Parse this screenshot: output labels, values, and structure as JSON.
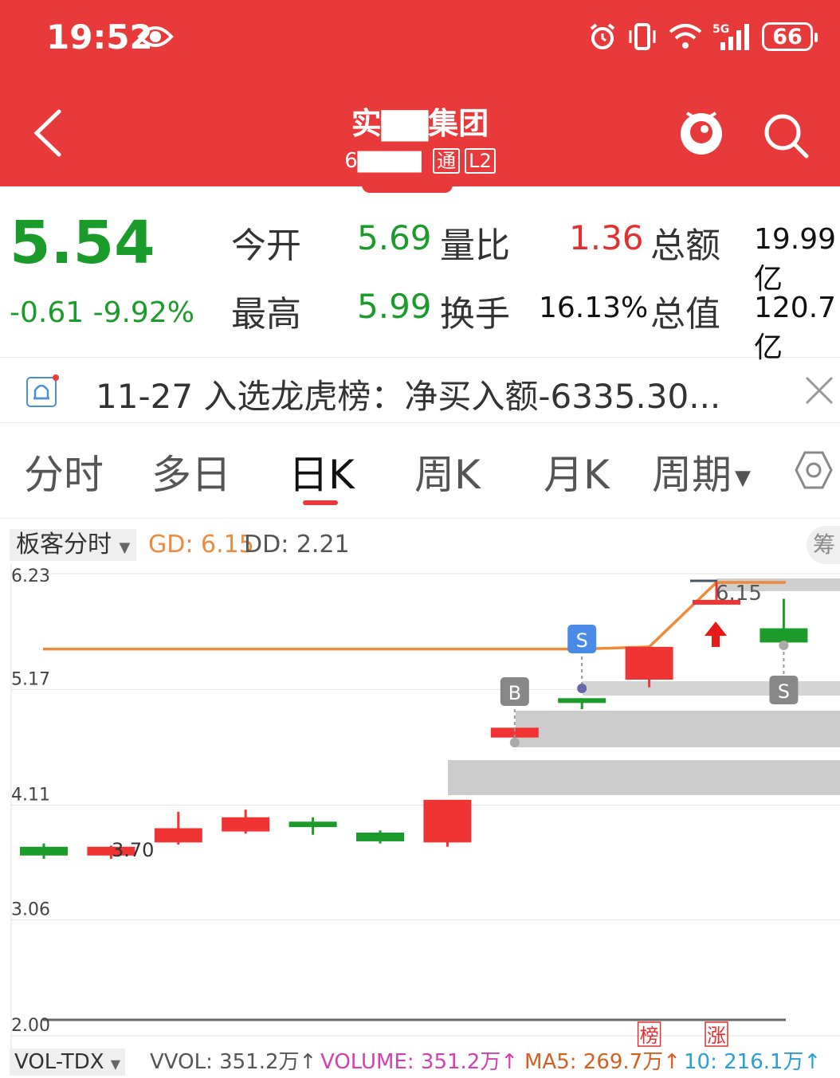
{
  "status_bar": {
    "time": "19:52",
    "network": "5G",
    "battery": "66"
  },
  "header": {
    "title": "实▇▇集团",
    "code": "6▇▇▇▇",
    "tag_tong": "通",
    "tag_l2": "L2"
  },
  "quote": {
    "price": "5.54",
    "change": "-0.61 -9.92%",
    "open_label": "今开",
    "open_value": "5.69",
    "high_label": "最高",
    "high_value": "5.99",
    "vol_ratio_label": "量比",
    "vol_ratio_value": "1.36",
    "turnover_label": "换手",
    "turnover_value": "16.13%",
    "amount_label": "总额",
    "amount_value": "19.99亿",
    "mktcap_label": "总值",
    "mktcap_value": "120.7亿"
  },
  "notice": {
    "text": "11-27 入选龙虎榜：净买入额-6335.30..."
  },
  "tabs": {
    "items": [
      "分时",
      "多日",
      "日K",
      "周K",
      "月K",
      "周期"
    ],
    "active": "日K"
  },
  "indicator": {
    "selected": "板客分时",
    "gd": "GD: 6.15",
    "dd": "DD: 2.21",
    "chip": "筹"
  },
  "chart_data": {
    "type": "candlestick",
    "y_ticks": [
      "6.23",
      "5.17",
      "4.11",
      "3.06",
      "2.00"
    ],
    "ylim": [
      2.0,
      6.23
    ],
    "candles": [
      {
        "open": 3.73,
        "close": 3.65,
        "high": 3.76,
        "low": 3.62,
        "color": "green"
      },
      {
        "open": 3.65,
        "close": 3.73,
        "high": 3.74,
        "low": 3.62,
        "color": "red"
      },
      {
        "open": 3.77,
        "close": 3.9,
        "high": 4.05,
        "low": 3.75,
        "color": "red"
      },
      {
        "open": 3.87,
        "close": 4.0,
        "high": 4.07,
        "low": 3.85,
        "color": "red"
      },
      {
        "open": 3.96,
        "close": 3.91,
        "high": 4.0,
        "low": 3.84,
        "color": "green"
      },
      {
        "open": 3.86,
        "close": 3.78,
        "high": 3.88,
        "low": 3.76,
        "color": "green"
      },
      {
        "open": 3.77,
        "close": 4.16,
        "high": 4.16,
        "low": 3.73,
        "color": "red"
      },
      {
        "open": 4.73,
        "close": 4.82,
        "high": 4.82,
        "low": 4.71,
        "color": "red"
      },
      {
        "open": 5.09,
        "close": 5.09,
        "high": 5.09,
        "low": 4.99,
        "color": "green"
      },
      {
        "open": 5.26,
        "close": 5.56,
        "high": 5.56,
        "low": 5.19,
        "color": "red"
      },
      {
        "open": 5.99,
        "close": 5.99,
        "high": 6.15,
        "low": 5.99,
        "color": "red"
      },
      {
        "open": 5.73,
        "close": 5.6,
        "high": 6.0,
        "low": 5.54,
        "color": "green"
      }
    ],
    "gd_line": [
      5.54,
      5.54,
      5.54,
      5.54,
      5.54,
      5.54,
      5.54,
      5.54,
      5.54,
      5.56,
      6.15,
      6.15
    ],
    "annotations": {
      "low_label": "3.70",
      "high_label": "6.15",
      "signals": [
        {
          "label": "B",
          "candle": 7
        },
        {
          "label": "S",
          "candle": 8
        },
        {
          "label": "S",
          "candle": 11
        }
      ],
      "markers": [
        {
          "label": "榜",
          "candle": 9
        },
        {
          "label": "涨",
          "candle": 10
        }
      ]
    }
  },
  "volume": {
    "selected": "VOL-TDX",
    "vvol": "VVOL: 351.2万↑",
    "volume": "VOLUME: 351.2万↑",
    "ma5": "MA5: 269.7万↑",
    "ma10": "10: 216.1万↑"
  },
  "colors": {
    "header_red": "#e83a3a",
    "up_red": "#f03333",
    "down_green": "#1a9b2a",
    "gd_orange": "#ee8a3b"
  }
}
